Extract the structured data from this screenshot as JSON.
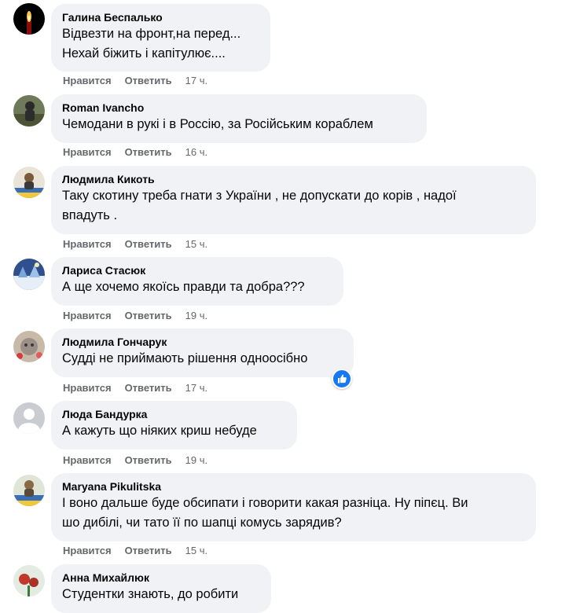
{
  "actions": {
    "like": "Нравится",
    "reply": "Ответить"
  },
  "comments": [
    {
      "author": "Галина Беспалько",
      "lines": [
        "Відвезти на фронт,на перед...",
        "Нехай біжить і капітулює...."
      ],
      "time": "17 ч."
    },
    {
      "author": "Roman Ivancho",
      "lines": [
        "Чемодани в рукі і в Россію, за Російським кораблем"
      ],
      "time": "16 ч."
    },
    {
      "author": "Людмила Кикоть",
      "lines": [
        "Таку скотину треба гнати з України , не допускати до корів , надої",
        "впадуть ."
      ],
      "time": "15 ч."
    },
    {
      "author": "Лариса Стасюк",
      "lines": [
        "А ще хочемо якоїсь правди та добра???"
      ],
      "time": "19 ч."
    },
    {
      "author": "Людмила Гончарук",
      "lines": [
        "Судді не приймають рішення одноосібно"
      ],
      "time": "17 ч.",
      "reaction": "like-icon"
    },
    {
      "author": "Люда Бандурка",
      "lines": [
        "А кажуть що ніяких криш небуде"
      ],
      "time": "19 ч."
    },
    {
      "author": "Maryana Pikulitska",
      "lines": [
        "І воно дальше буде обсипати і говорити какая разніца. Ну піпєц. Ви",
        "шо дибілі, чи тато її по шапці комусь зарядив?"
      ],
      "time": "15 ч."
    },
    {
      "author": "Анна Михайлюк",
      "lines": [
        "Студентки знають, до робити"
      ]
    }
  ]
}
